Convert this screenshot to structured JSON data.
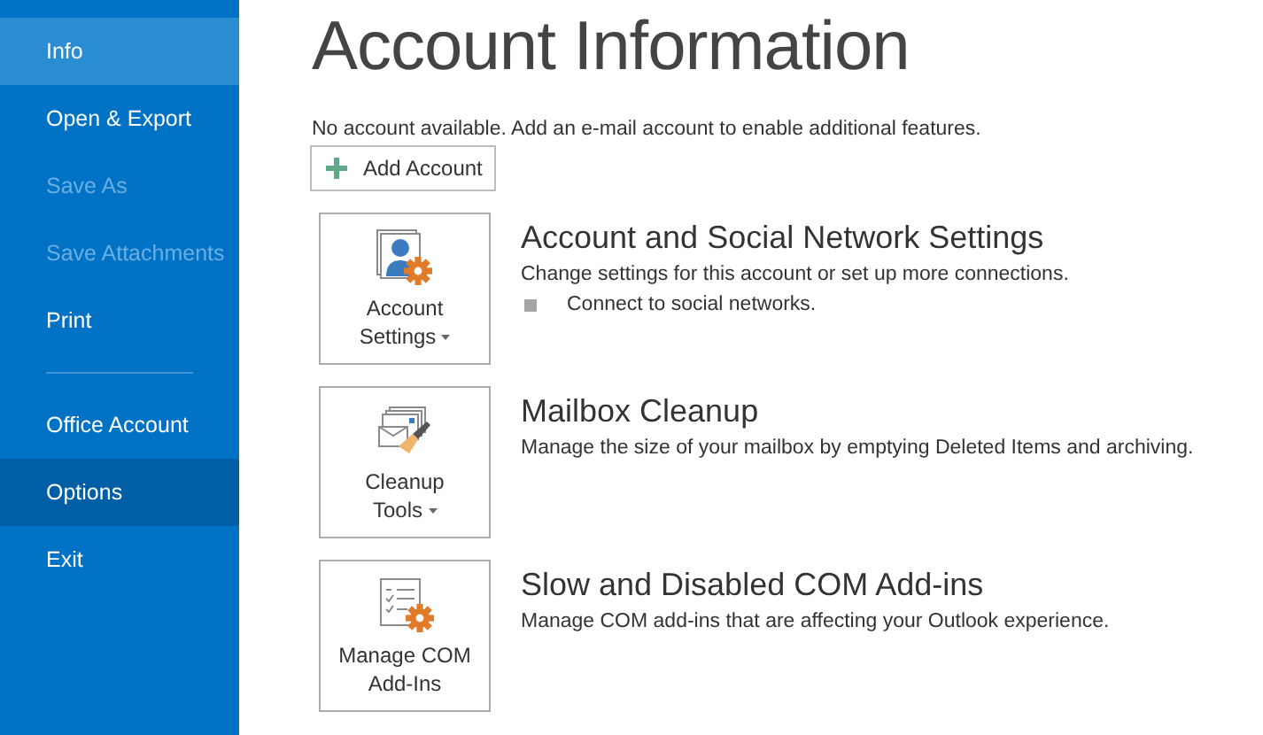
{
  "sidebar": {
    "items": [
      {
        "kind": "item",
        "label": "Info",
        "selected": true,
        "disabled": false,
        "hovered": false
      },
      {
        "kind": "item",
        "label": "Open & Export",
        "selected": false,
        "disabled": false,
        "hovered": false
      },
      {
        "kind": "item",
        "label": "Save As",
        "selected": false,
        "disabled": true,
        "hovered": false
      },
      {
        "kind": "item",
        "label": "Save Attachments",
        "selected": false,
        "disabled": true,
        "hovered": false
      },
      {
        "kind": "item",
        "label": "Print",
        "selected": false,
        "disabled": false,
        "hovered": false
      },
      {
        "kind": "separator"
      },
      {
        "kind": "item",
        "label": "Office Account",
        "selected": false,
        "disabled": false,
        "hovered": false
      },
      {
        "kind": "item",
        "label": "Options",
        "selected": false,
        "disabled": false,
        "hovered": true
      },
      {
        "kind": "item",
        "label": "Exit",
        "selected": false,
        "disabled": false,
        "hovered": false
      }
    ]
  },
  "page": {
    "title": "Account Information",
    "note": "No account available. Add an e-mail account to enable additional features.",
    "add_button": "Add Account"
  },
  "sections": [
    {
      "kind": "account",
      "button_lines": [
        "Account",
        "Settings"
      ],
      "dropdown": true,
      "heading": "Account and Social Network Settings",
      "description": "Change settings for this account or set up more connections.",
      "bullets": [
        "Connect to social networks."
      ]
    },
    {
      "kind": "cleanup",
      "button_lines": [
        "Cleanup",
        "Tools"
      ],
      "dropdown": true,
      "heading": "Mailbox Cleanup",
      "description": "Manage the size of your mailbox by emptying Deleted Items and archiving."
    },
    {
      "kind": "com",
      "button_lines": [
        "Manage COM",
        "Add-Ins"
      ],
      "dropdown": false,
      "heading": "Slow and Disabled COM Add-ins",
      "description": "Manage COM add-ins that are affecting your Outlook experience."
    }
  ]
}
